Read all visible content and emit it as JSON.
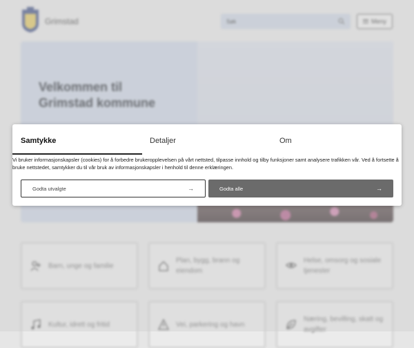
{
  "header": {
    "site_name": "Grimstad",
    "search_placeholder": "Søk",
    "menu_label": "Meny"
  },
  "hero": {
    "title_line1": "Velkommen til",
    "title_line2": "Grimstad kommune"
  },
  "cards": [
    {
      "label": "Barn, unge og familie",
      "icon": "person-add-icon"
    },
    {
      "label": "Plan, bygg, brann og eiendom",
      "icon": "house-icon"
    },
    {
      "label": "Helse, omsorg og sosiale tjenester",
      "icon": "handshake-icon"
    },
    {
      "label": "Kultur, idrett og fritid",
      "icon": "music-note-icon"
    },
    {
      "label": "Vei, parkering og havn",
      "icon": "warning-triangle-icon"
    },
    {
      "label": "Næring, bevilling, skatt og avgifter",
      "icon": "leaf-icon"
    }
  ],
  "consent": {
    "tabs": [
      "Samtykke",
      "Detaljer",
      "Om"
    ],
    "text": "Vi bruker informasjonskapsler (cookies) for å forbedre brukeropplevelsen på vårt nettsted, tilpasse innhold og tilby funksjoner samt analysere trafikken vår. Ved å fortsette å bruke nettstedet, samtykker du til vår bruk av informasjonskapsler i henhold til denne erklæringen.",
    "btn_selected": "Godta utvalgte",
    "btn_all": "Godta alle"
  }
}
